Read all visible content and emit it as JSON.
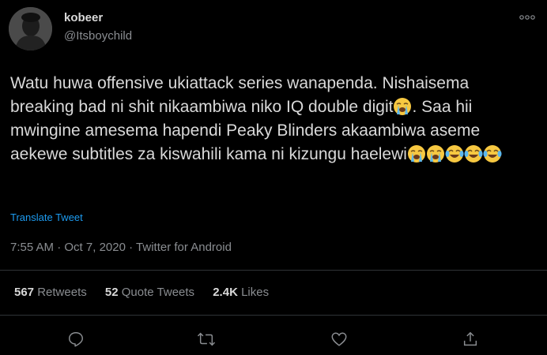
{
  "author": {
    "display_name": "kobeer",
    "handle": "@Itsboychild",
    "avatar_icon": "user-avatar-photo"
  },
  "header": {
    "more_icon": "more-icon"
  },
  "tweet": {
    "text_segments": [
      "Watu huwa offensive ukiattack series wanapenda. Nishaisema breaking bad ni shit nikaambiwa niko IQ double digit",
      ". Saa hii mwingine amesema hapendi Peaky Blinders akaambiwa aseme aekewe subtitles za kiswahili kama ni kizungu haelewi"
    ],
    "emojis": {
      "loudly_crying_face": "loudly-crying-face-emoji",
      "face_with_tears_of_joy": "face-with-tears-of-joy-emoji"
    }
  },
  "translate_label": "Translate Tweet",
  "meta": {
    "time": "7:55 AM",
    "separator": "·",
    "date": "Oct 7, 2020",
    "source": "Twitter for Android"
  },
  "stats": {
    "retweets_count": "567",
    "retweets_label": "Retweets",
    "quote_count": "52",
    "quote_label": "Quote Tweets",
    "likes_count": "2.4K",
    "likes_label": "Likes"
  },
  "actions": {
    "reply_icon": "reply-icon",
    "retweet_icon": "retweet-icon",
    "like_icon": "heart-icon",
    "share_icon": "share-icon"
  },
  "colors": {
    "background": "#000000",
    "text": "#d9d9d9",
    "secondary": "#8a8d91",
    "link": "#1d9bf0",
    "divider": "#2f3336"
  }
}
